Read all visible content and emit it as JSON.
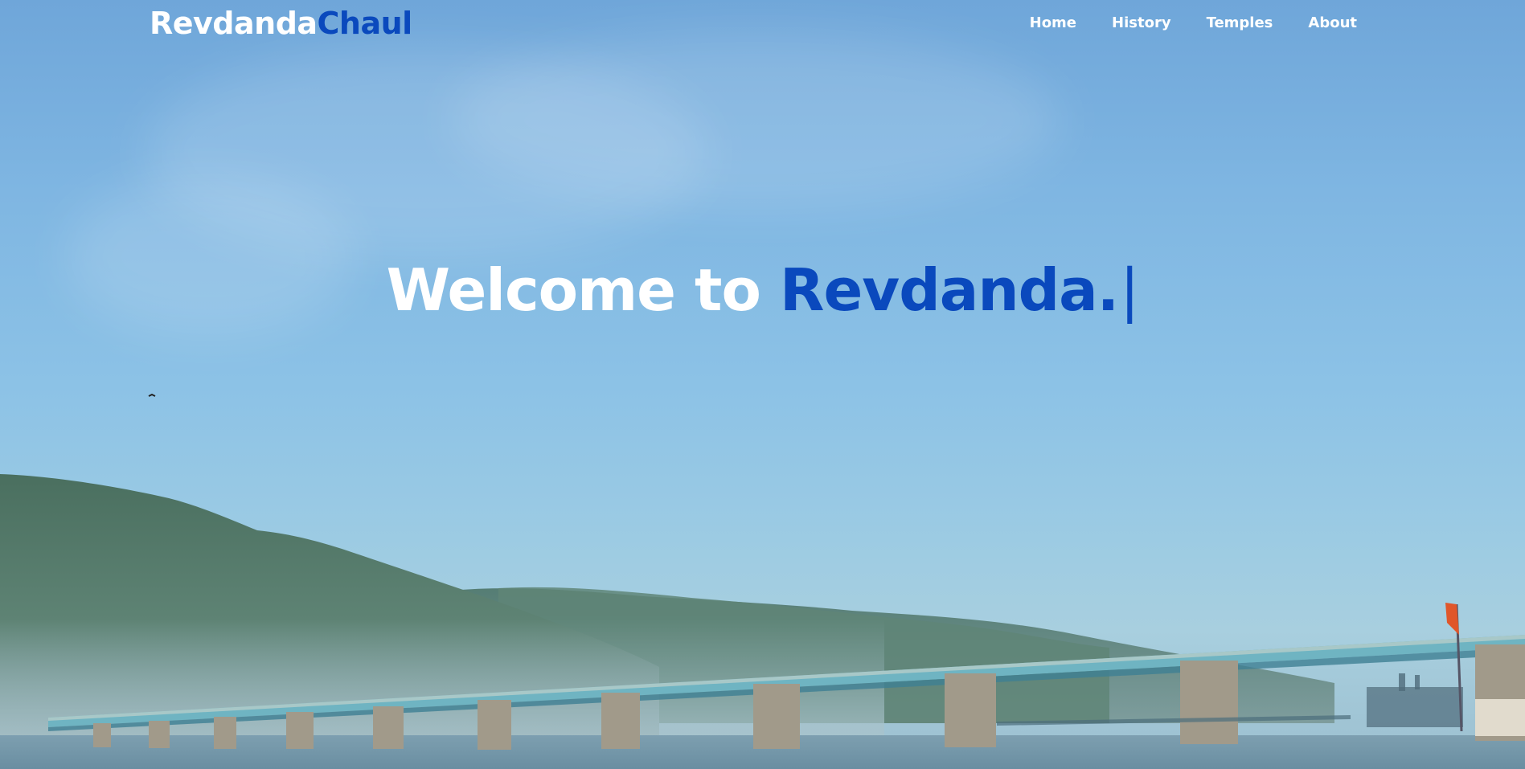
{
  "brand": {
    "part1": "Revdanda",
    "part2": "Chaul"
  },
  "nav": {
    "items": [
      {
        "label": "Home"
      },
      {
        "label": "History"
      },
      {
        "label": "Temples"
      },
      {
        "label": "About"
      }
    ]
  },
  "hero": {
    "headline_white": "Welcome to",
    "headline_blue": "Revdanda.",
    "cursor": "|"
  },
  "colors": {
    "accent": "#0a49bd",
    "text_light": "#ffffff"
  }
}
